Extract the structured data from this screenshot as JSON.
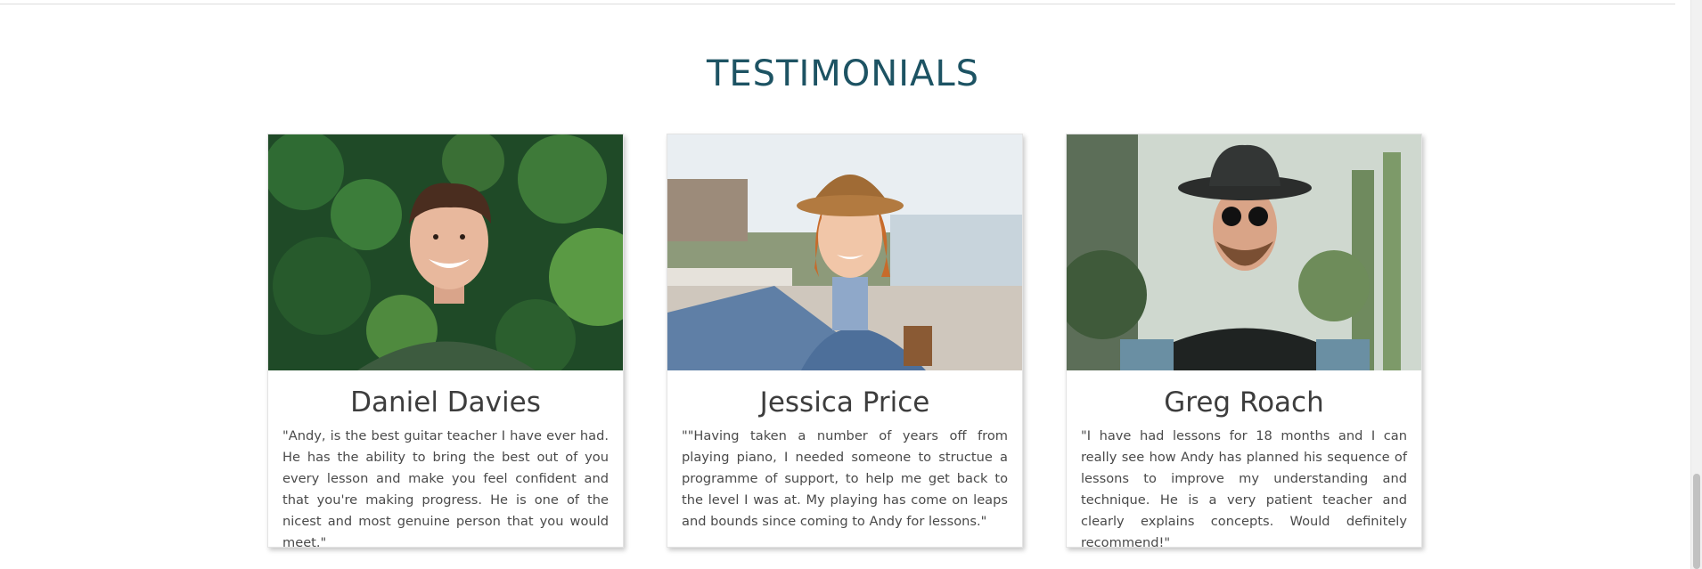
{
  "section": {
    "title": "TESTIMONIALS"
  },
  "testimonials": [
    {
      "name": "Daniel Davies",
      "quote": "\"Andy, is the best guitar teacher I have ever had. He has the ability to bring the best out of you every lesson and make you feel confident and that you're making progress. He is one of the nicest and most genuine person that you would meet.\"",
      "photo_alt": "Smiling young man in front of a wall of green plants"
    },
    {
      "name": "Jessica Price",
      "quote": "\"\"Having taken a number of years off from playing piano, I needed someone to structue a programme of support, to help me get back to the level I was at. My playing has come on leaps and bounds since coming to Andy for lessons.\"",
      "photo_alt": "Young woman in a hat and denim jacket taking a selfie by the water"
    },
    {
      "name": "Greg Roach",
      "quote": "\"I have had lessons for 18 months and I can really see how Andy has planned his sequence of lessons to improve my understanding and technique. He is a very patient teacher and clearly explains concepts. Would definitely recommend!\"",
      "photo_alt": "Bearded man in a hat and round sunglasses among cacti"
    }
  ],
  "colors": {
    "heading": "#1d5363",
    "text": "#4a4a4a",
    "name": "#3d3d3d"
  }
}
